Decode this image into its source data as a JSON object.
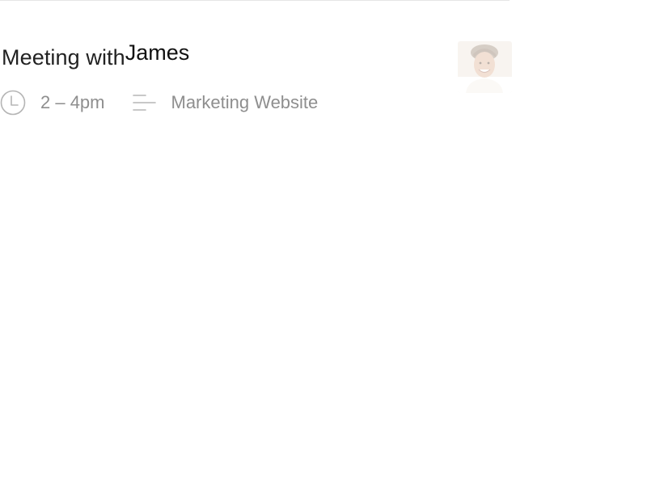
{
  "event": {
    "title_prefix": "Meeting with",
    "attendee_name": "James",
    "time_range": "2 – 4pm",
    "project": "Marketing Website"
  },
  "icons": {
    "time": "clock-icon",
    "project": "lines-icon",
    "attendee": "avatar"
  },
  "colors": {
    "title": "#222222",
    "meta_text": "#8e8e8e",
    "icon": "#b5b5b5",
    "divider": "#e6e6e6"
  }
}
